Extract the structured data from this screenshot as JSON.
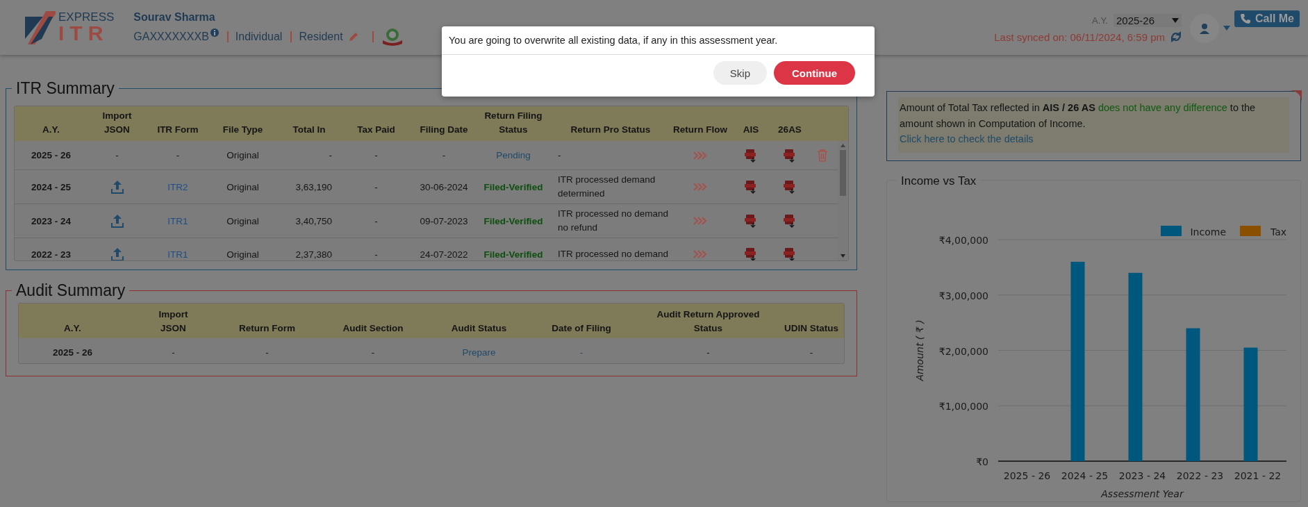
{
  "header": {
    "logo": {
      "top": "EXPRESS",
      "bottom": "ITR"
    },
    "user_name": "Sourav Sharma",
    "pan": "GAXXXXXXXB",
    "category": "Individual",
    "residency": "Resident",
    "ay_label": "A.Y.",
    "ay_value": "2025-26",
    "last_synced": "Last synced on: 06/11/2024, 6:59 pm",
    "call_button": "Call Me"
  },
  "modal": {
    "message": "You are going to overwrite all existing data, if any in this assessment year.",
    "buttons": [
      {
        "label": "Skip",
        "kind": "secondary"
      },
      {
        "label": "Continue",
        "kind": "primary"
      }
    ]
  },
  "itr_summary": {
    "title": "ITR Summary",
    "columns": [
      {
        "lines": [
          "A.Y."
        ]
      },
      {
        "lines": [
          "Import",
          "JSON"
        ]
      },
      {
        "lines": [
          "ITR Form"
        ]
      },
      {
        "lines": [
          "File Type"
        ]
      },
      {
        "lines": [
          "Total In"
        ]
      },
      {
        "lines": [
          "Tax Paid"
        ]
      },
      {
        "lines": [
          "Filing Date"
        ]
      },
      {
        "lines": [
          "Return Filing",
          "Status"
        ]
      },
      {
        "lines": [
          "Return Pro Status"
        ]
      },
      {
        "lines": [
          "Return Flow"
        ]
      },
      {
        "lines": [
          "AIS"
        ]
      },
      {
        "lines": [
          "26AS"
        ]
      }
    ],
    "rows": [
      {
        "ay": "2025 - 26",
        "import": false,
        "import_text": "-",
        "itr_form": "-",
        "file_type": "Original",
        "total_in": "-",
        "tax_paid": "-",
        "filing_date": "-",
        "status": {
          "text": "Pending",
          "kind": "pending"
        },
        "pro_status": "-",
        "deletable": true
      },
      {
        "ay": "2024 - 25",
        "import": true,
        "itr_form": "ITR2",
        "file_type": "Original",
        "total_in": "3,63,190",
        "tax_paid": "-",
        "filing_date": "30-06-2024",
        "status": {
          "text": "Filed-Verified",
          "kind": "filed"
        },
        "pro_status": "ITR processed demand determined",
        "deletable": false
      },
      {
        "ay": "2023 - 24",
        "import": true,
        "itr_form": "ITR1",
        "file_type": "Original",
        "total_in": "3,40,750",
        "tax_paid": "-",
        "filing_date": "09-07-2023",
        "status": {
          "text": "Filed-Verified",
          "kind": "filed"
        },
        "pro_status": "ITR processed no demand no refund",
        "deletable": false
      },
      {
        "ay": "2022 - 23",
        "import": true,
        "itr_form": "ITR1",
        "file_type": "Original",
        "total_in": "2,37,380",
        "tax_paid": "-",
        "filing_date": "24-07-2022",
        "status": {
          "text": "Filed-Verified",
          "kind": "filed"
        },
        "pro_status": "ITR processed no demand",
        "deletable": false
      }
    ]
  },
  "audit_summary": {
    "title": "Audit Summary",
    "columns": [
      {
        "lines": [
          "A.Y."
        ]
      },
      {
        "lines": [
          "Import",
          "JSON"
        ]
      },
      {
        "lines": [
          "Return Form"
        ]
      },
      {
        "lines": [
          "Audit Section"
        ]
      },
      {
        "lines": [
          "Audit Status"
        ]
      },
      {
        "lines": [
          "Date of Filing"
        ]
      },
      {
        "lines": [
          "Audit Return Approved",
          "Status"
        ]
      },
      {
        "lines": [
          "UDIN Status"
        ]
      }
    ],
    "rows": [
      [
        {
          "text": "2025 - 26",
          "kind": "bold"
        },
        {
          "text": "-",
          "kind": "plain"
        },
        {
          "text": "-",
          "kind": "plain"
        },
        {
          "text": "-",
          "kind": "plain"
        },
        {
          "text": "Prepare",
          "kind": "link"
        },
        {
          "text": "-",
          "kind": "link"
        },
        {
          "text": "-",
          "kind": "plain"
        },
        {
          "text": "-",
          "kind": "plain"
        }
      ]
    ]
  },
  "tax_notice": {
    "text": "Amount of Total Tax reflected in **AIS / 26 AS** ",
    "highlight": "does not have any difference",
    "rest": " to the amount shown in Computation of Income.",
    "link": "Click here to check the details"
  },
  "income_chart": {
    "title": "Income vs Tax",
    "chart_data": {
      "type": "bar",
      "xlabel": "Assessment Year",
      "ylabel": "Amount ( ₹ )",
      "categories": [
        "2025 - 26",
        "2024 - 25",
        "2023 - 24",
        "2022 - 23",
        "2021 - 22"
      ],
      "series": [
        {
          "name": "Income",
          "color": "#00577e",
          "values": [
            0,
            360000,
            340000,
            240000,
            205000
          ]
        },
        {
          "name": "Tax",
          "color": "#8a5000",
          "values": [
            0,
            0,
            0,
            0,
            0
          ]
        }
      ],
      "grid": true,
      "ylim": [
        0,
        400000
      ],
      "yticks": [
        {
          "value": 0,
          "label": "₹0"
        },
        {
          "value": 100000,
          "label": "₹1,00,000"
        },
        {
          "value": 200000,
          "label": "₹2,00,000"
        },
        {
          "value": 300000,
          "label": "₹3,00,000"
        },
        {
          "value": 400000,
          "label": "₹4,00,000"
        }
      ]
    }
  }
}
